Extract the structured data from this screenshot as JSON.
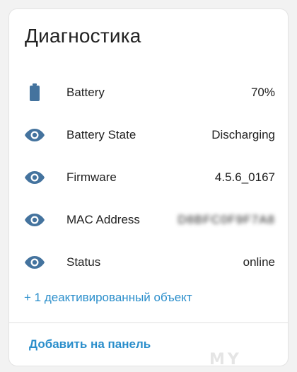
{
  "card": {
    "title": "Диагностика",
    "rows": [
      {
        "icon": "battery-icon",
        "label": "Battery",
        "value": "70%"
      },
      {
        "icon": "eye-icon",
        "label": "Battery State",
        "value": "Discharging"
      },
      {
        "icon": "eye-icon",
        "label": "Firmware",
        "value": "4.5.6_0167"
      },
      {
        "icon": "eye-icon",
        "label": "MAC Address",
        "value": "D8BFC0F9F7A8"
      },
      {
        "icon": "eye-icon",
        "label": "Status",
        "value": "online"
      }
    ],
    "more_link": "+ 1 деактивированный объект",
    "add_button": "Добавить на панель"
  },
  "watermark": "MY",
  "colors": {
    "icon": "#44739e",
    "link": "#2a8ecb",
    "text": "#212121"
  }
}
